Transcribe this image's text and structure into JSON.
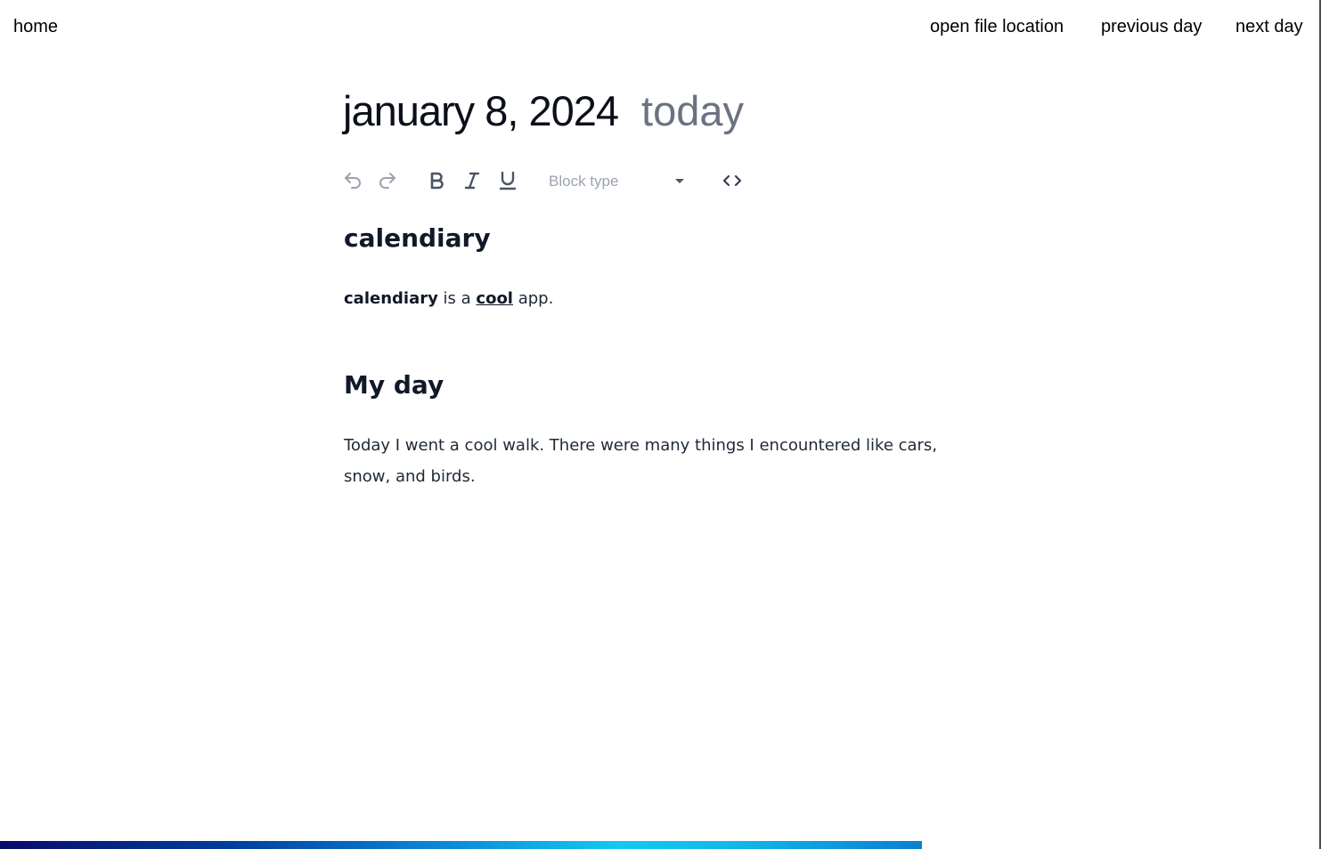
{
  "nav": {
    "home": "home",
    "open_file_location": "open file location",
    "previous_day": "previous day",
    "next_day": "next day"
  },
  "header": {
    "date": "january 8, 2024",
    "today": "today"
  },
  "toolbar": {
    "undo_icon": "undo-icon",
    "redo_icon": "redo-icon",
    "bold_icon": "bold-icon",
    "italic_icon": "italic-icon",
    "underline_icon": "underline-icon",
    "block_type_label": "Block type",
    "code_icon": "code-icon"
  },
  "document": {
    "heading1": "calendiary",
    "intro": {
      "bold": "calendiary",
      "mid": " is a ",
      "underlined": "cool",
      "end": " app."
    },
    "heading2": "My day",
    "paragraph": "Today I went a cool walk. There were many things I encountered like cars, snow, and birds."
  },
  "progress": {
    "value": 0.698
  },
  "colors": {
    "muted_text": "#6b7280",
    "placeholder": "#9ca3af",
    "progress_start": "#0a0a6a",
    "progress_mid": "#12c9f0"
  }
}
